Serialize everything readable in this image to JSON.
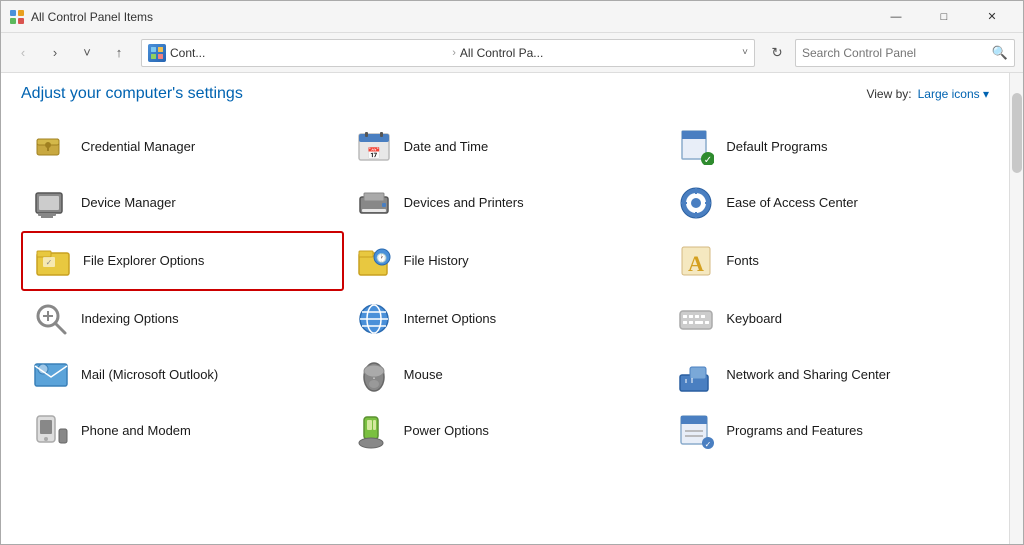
{
  "window": {
    "title": "All Control Panel Items",
    "icon": "🖥️"
  },
  "titlebar": {
    "title": "All Control Panel Items",
    "minimize": "—",
    "maximize": "□",
    "close": "✕"
  },
  "navbar": {
    "back": "‹",
    "forward": "›",
    "down": "˅",
    "up": "↑",
    "address_part1": "Cont...",
    "address_sep1": "›",
    "address_part2": "All Control Pa...",
    "dropdown": "˅",
    "refresh": "↻",
    "search_placeholder": "Search Control Panel",
    "search_icon": "🔍"
  },
  "header": {
    "title": "Adjust your computer's settings",
    "view_by_label": "View by:",
    "view_by_value": "Large icons ▾"
  },
  "items": [
    {
      "id": "credential-manager",
      "label": "Credential Manager",
      "icon": "🔑",
      "highlighted": false
    },
    {
      "id": "date-time",
      "label": "Date and Time",
      "icon": "📅",
      "highlighted": false
    },
    {
      "id": "default-programs",
      "label": "Default Programs",
      "icon": "📋",
      "highlighted": false
    },
    {
      "id": "device-manager",
      "label": "Device Manager",
      "icon": "🖨️",
      "highlighted": false
    },
    {
      "id": "devices-printers",
      "label": "Devices and Printers",
      "icon": "🖨️",
      "highlighted": false
    },
    {
      "id": "ease-access",
      "label": "Ease of Access Center",
      "icon": "♿",
      "highlighted": false
    },
    {
      "id": "file-explorer",
      "label": "File Explorer Options",
      "icon": "📁",
      "highlighted": true
    },
    {
      "id": "file-history",
      "label": "File History",
      "icon": "📂",
      "highlighted": false
    },
    {
      "id": "fonts",
      "label": "Fonts",
      "icon": "🅰",
      "highlighted": false
    },
    {
      "id": "indexing",
      "label": "Indexing Options",
      "icon": "🔍",
      "highlighted": false
    },
    {
      "id": "internet",
      "label": "Internet Options",
      "icon": "🌐",
      "highlighted": false
    },
    {
      "id": "keyboard",
      "label": "Keyboard",
      "icon": "⌨️",
      "highlighted": false
    },
    {
      "id": "mail",
      "label": "Mail (Microsoft Outlook)",
      "icon": "📧",
      "highlighted": false
    },
    {
      "id": "mouse",
      "label": "Mouse",
      "icon": "🖱️",
      "highlighted": false
    },
    {
      "id": "network",
      "label": "Network and Sharing Center",
      "icon": "🌐",
      "highlighted": false
    },
    {
      "id": "phone",
      "label": "Phone and Modem",
      "icon": "📞",
      "highlighted": false
    },
    {
      "id": "power",
      "label": "Power Options",
      "icon": "🔋",
      "highlighted": false
    },
    {
      "id": "programs",
      "label": "Programs and Features",
      "icon": "📄",
      "highlighted": false
    }
  ]
}
